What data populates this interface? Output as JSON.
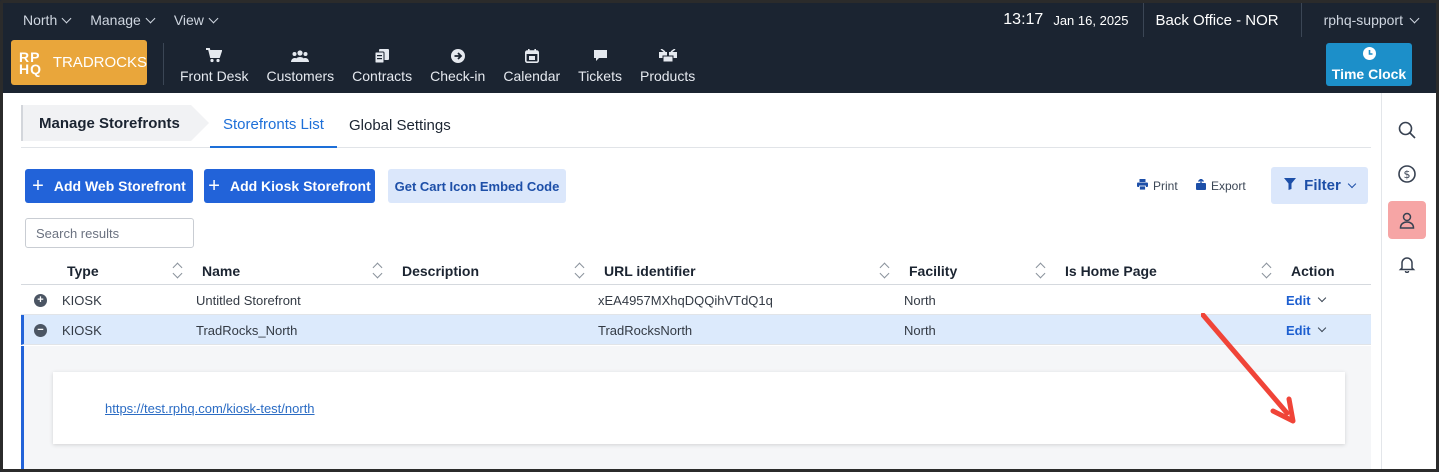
{
  "topbar": {
    "menus": [
      {
        "label": "North"
      },
      {
        "label": "Manage"
      },
      {
        "label": "View"
      }
    ],
    "time": "13:17",
    "date": "Jan 16, 2025",
    "office": "Back Office - NOR",
    "user": "rphq-support"
  },
  "logo": {
    "mark_top": "RP",
    "mark_bottom": "HQ",
    "name": "TRADROCKS"
  },
  "nav": {
    "items": [
      {
        "label": "Front Desk",
        "icon": "cart-icon"
      },
      {
        "label": "Customers",
        "icon": "users-icon"
      },
      {
        "label": "Contracts",
        "icon": "contracts-icon"
      },
      {
        "label": "Check-in",
        "icon": "arrow-circle-icon"
      },
      {
        "label": "Calendar",
        "icon": "calendar-icon"
      },
      {
        "label": "Tickets",
        "icon": "chat-icon"
      },
      {
        "label": "Products",
        "icon": "boxes-icon"
      }
    ],
    "time_clock": "Time Clock"
  },
  "page": {
    "breadcrumb": "Manage Storefronts",
    "tabs": [
      {
        "label": "Storefronts List",
        "active": true
      },
      {
        "label": "Global Settings",
        "active": false
      }
    ]
  },
  "toolbar": {
    "add_web": "Add Web Storefront",
    "add_kiosk": "Add Kiosk Storefront",
    "embed_code": "Get Cart Icon Embed Code",
    "print": "Print",
    "export": "Export",
    "filter": "Filter"
  },
  "search": {
    "placeholder": "Search results"
  },
  "table": {
    "columns": [
      "Type",
      "Name",
      "Description",
      "URL identifier",
      "Facility",
      "Is Home Page",
      "Action"
    ],
    "rows": [
      {
        "type": "KIOSK",
        "name": "Untitled Storefront",
        "description": "",
        "url_identifier": "xEA4957MXhqDQQihVTdQ1q",
        "facility": "North",
        "is_home_page": "",
        "action": "Edit",
        "expanded": false
      },
      {
        "type": "KIOSK",
        "name": "TradRocks_North",
        "description": "",
        "url_identifier": "TradRocksNorth",
        "facility": "North",
        "is_home_page": "",
        "action": "Edit",
        "expanded": true
      }
    ],
    "detail_link": "https://test.rphq.com/kiosk-test/north"
  },
  "colors": {
    "header_bg": "#1b2431",
    "primary": "#2263d9",
    "logo": "#e9a63b",
    "time_clock": "#1c8fc9",
    "annotation_arrow": "#f04438"
  }
}
